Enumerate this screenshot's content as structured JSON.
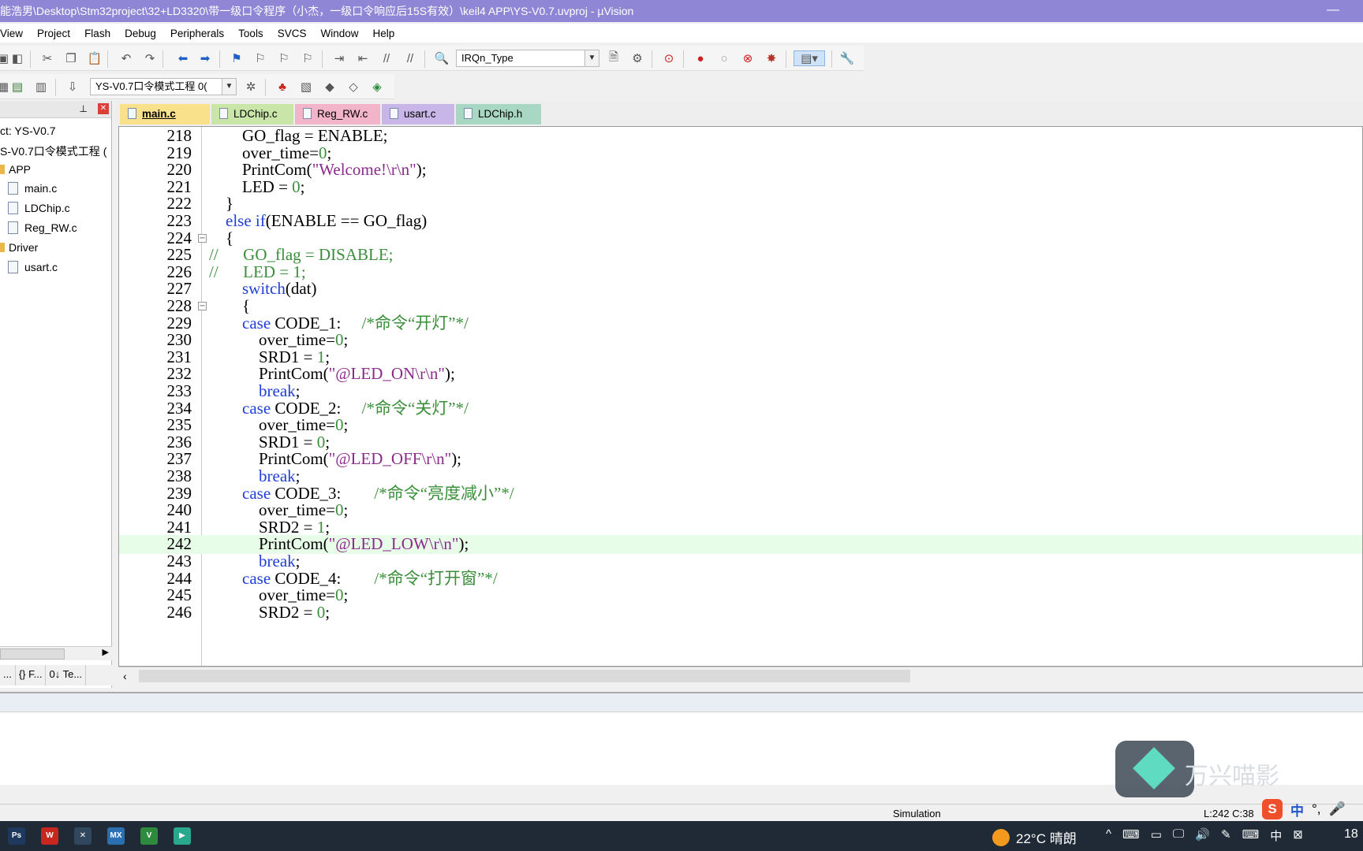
{
  "window": {
    "title": "能浩男\\Desktop\\Stm32project\\32+LD3320\\带一级口令程序（小杰，一级口令响应后15S有效）\\keil4 APP\\YS-V0.7.uvproj - µVision",
    "minimize_glyph": "—"
  },
  "menu": [
    "View",
    "Project",
    "Flash",
    "Debug",
    "Peripherals",
    "Tools",
    "SVCS",
    "Window",
    "Help"
  ],
  "toolbar": {
    "function_combo": "IRQn_Type",
    "target_combo": "YS-V0.7口令模式工程 0("
  },
  "project_panel": {
    "project_label": "ct: YS-V0.7",
    "target_label": "S-V0.7口令模式工程 (",
    "groups": [
      {
        "name": "APP",
        "files": [
          "main.c",
          "LDChip.c",
          "Reg_RW.c"
        ]
      },
      {
        "name": "Driver",
        "files": [
          "usart.c"
        ]
      }
    ],
    "tabs": [
      "...",
      "{} F...",
      "0↓ Te..."
    ]
  },
  "editor_tabs": [
    {
      "label": "main.c",
      "active": true,
      "color": "#f9e08a"
    },
    {
      "label": "LDChip.c",
      "active": false,
      "color": "#c9e6a8"
    },
    {
      "label": "Reg_RW.c",
      "active": false,
      "color": "#f2b4c8"
    },
    {
      "label": "usart.c",
      "active": false,
      "color": "#c9b6e8"
    },
    {
      "label": "LDChip.h",
      "active": false,
      "color": "#a8d8c4"
    }
  ],
  "code_lines": [
    {
      "n": "218",
      "fold": "",
      "parts": [
        [
          "fn",
          "        GO_flag = ENABLE;"
        ]
      ]
    },
    {
      "n": "219",
      "fold": "",
      "parts": [
        [
          "fn",
          "        over_time="
        ],
        [
          "num",
          "0"
        ],
        [
          "fn",
          ";"
        ]
      ]
    },
    {
      "n": "220",
      "fold": "",
      "parts": [
        [
          "fn",
          "        PrintCom("
        ],
        [
          "str",
          "\"Welcome!\\r\\n\""
        ],
        [
          "fn",
          ");"
        ]
      ]
    },
    {
      "n": "221",
      "fold": "",
      "parts": [
        [
          "fn",
          "        LED = "
        ],
        [
          "num",
          "0"
        ],
        [
          "fn",
          ";"
        ]
      ]
    },
    {
      "n": "222",
      "fold": "",
      "parts": [
        [
          "fn",
          "    }"
        ]
      ]
    },
    {
      "n": "223",
      "fold": "",
      "parts": [
        [
          "kw",
          "    else if"
        ],
        [
          "fn",
          "(ENABLE == GO_flag)"
        ]
      ]
    },
    {
      "n": "224",
      "fold": "−",
      "parts": [
        [
          "fn",
          "    {"
        ]
      ]
    },
    {
      "n": "225",
      "fold": "",
      "parts": [
        [
          "cm",
          "//      GO_flag = DISABLE;"
        ]
      ]
    },
    {
      "n": "226",
      "fold": "",
      "parts": [
        [
          "cm",
          "//      LED = 1;"
        ]
      ]
    },
    {
      "n": "227",
      "fold": "",
      "parts": [
        [
          "kw",
          "        switch"
        ],
        [
          "fn",
          "(dat)"
        ]
      ]
    },
    {
      "n": "228",
      "fold": "−",
      "parts": [
        [
          "fn",
          "        {"
        ]
      ]
    },
    {
      "n": "229",
      "fold": "",
      "parts": [
        [
          "kw",
          "        case"
        ],
        [
          "fn",
          " CODE_1:     "
        ],
        [
          "cm",
          "/*命令“开灯”*/"
        ]
      ]
    },
    {
      "n": "230",
      "fold": "",
      "parts": [
        [
          "fn",
          "            over_time="
        ],
        [
          "num",
          "0"
        ],
        [
          "fn",
          ";"
        ]
      ]
    },
    {
      "n": "231",
      "fold": "",
      "parts": [
        [
          "fn",
          "            SRD1 = "
        ],
        [
          "num",
          "1"
        ],
        [
          "fn",
          ";"
        ]
      ]
    },
    {
      "n": "232",
      "fold": "",
      "parts": [
        [
          "fn",
          "            PrintCom("
        ],
        [
          "str",
          "\"@LED_ON\\r\\n\""
        ],
        [
          "fn",
          ");"
        ]
      ]
    },
    {
      "n": "233",
      "fold": "",
      "parts": [
        [
          "kw",
          "            break"
        ],
        [
          "fn",
          ";"
        ]
      ]
    },
    {
      "n": "234",
      "fold": "",
      "parts": [
        [
          "kw",
          "        case"
        ],
        [
          "fn",
          " CODE_2:     "
        ],
        [
          "cm",
          "/*命令“关灯”*/"
        ]
      ]
    },
    {
      "n": "235",
      "fold": "",
      "parts": [
        [
          "fn",
          "            over_time="
        ],
        [
          "num",
          "0"
        ],
        [
          "fn",
          ";"
        ]
      ]
    },
    {
      "n": "236",
      "fold": "",
      "parts": [
        [
          "fn",
          "            SRD1 = "
        ],
        [
          "num",
          "0"
        ],
        [
          "fn",
          ";"
        ]
      ]
    },
    {
      "n": "237",
      "fold": "",
      "parts": [
        [
          "fn",
          "            PrintCom("
        ],
        [
          "str",
          "\"@LED_OFF\\r\\n\""
        ],
        [
          "fn",
          ");"
        ]
      ]
    },
    {
      "n": "238",
      "fold": "",
      "parts": [
        [
          "kw",
          "            break"
        ],
        [
          "fn",
          ";"
        ]
      ]
    },
    {
      "n": "239",
      "fold": "",
      "parts": [
        [
          "kw",
          "        case"
        ],
        [
          "fn",
          " CODE_3:        "
        ],
        [
          "cm",
          "/*命令“亮度减小”*/"
        ]
      ]
    },
    {
      "n": "240",
      "fold": "",
      "parts": [
        [
          "fn",
          "            over_time="
        ],
        [
          "num",
          "0"
        ],
        [
          "fn",
          ";"
        ]
      ]
    },
    {
      "n": "241",
      "fold": "",
      "parts": [
        [
          "fn",
          "            SRD2 = "
        ],
        [
          "num",
          "1"
        ],
        [
          "fn",
          ";"
        ]
      ]
    },
    {
      "n": "242",
      "fold": "",
      "hl": true,
      "parts": [
        [
          "fn",
          "            PrintCom("
        ],
        [
          "str",
          "\"@LED_LOW\\r\\n\""
        ],
        [
          "fn",
          ");"
        ]
      ]
    },
    {
      "n": "243",
      "fold": "",
      "parts": [
        [
          "kw",
          "            break"
        ],
        [
          "fn",
          ";"
        ]
      ]
    },
    {
      "n": "244",
      "fold": "",
      "parts": [
        [
          "kw",
          "        case"
        ],
        [
          "fn",
          " CODE_4:        "
        ],
        [
          "cm",
          "/*命令“打开窗”*/"
        ]
      ]
    },
    {
      "n": "245",
      "fold": "",
      "parts": [
        [
          "fn",
          "            over_time="
        ],
        [
          "num",
          "0"
        ],
        [
          "fn",
          ";"
        ]
      ]
    },
    {
      "n": "246",
      "fold": "",
      "parts": [
        [
          "fn",
          "            SRD2 = "
        ],
        [
          "num",
          "0"
        ],
        [
          "fn",
          ";"
        ]
      ]
    }
  ],
  "status": {
    "mode": "Simulation",
    "cursor": "L:242 C:38"
  },
  "overlay": {
    "watermark": "万兴喵影",
    "ime_mode": "中",
    "ime_punct": "°,"
  },
  "taskbar": {
    "apps": [
      {
        "icon": "photoshop-icon",
        "label": "Ps",
        "color": "#1d3a5e"
      },
      {
        "icon": "wps-icon",
        "label": "W",
        "color": "#c8261e"
      },
      {
        "icon": "tool-icon",
        "label": "✕",
        "color": "#31475e"
      },
      {
        "icon": "mx-icon",
        "label": "MX",
        "color": "#2b6fb3"
      },
      {
        "icon": "keil-icon",
        "label": "V",
        "color": "#2e8b3e"
      },
      {
        "icon": "filmora-icon",
        "label": "▶",
        "color": "#2aa88e"
      }
    ],
    "weather": "22°C 晴朗",
    "tray": [
      "^",
      "⌨",
      "▭",
      "🖵",
      "🔊",
      "✎",
      "⌨",
      "中",
      "⊠"
    ],
    "clock": "18"
  }
}
